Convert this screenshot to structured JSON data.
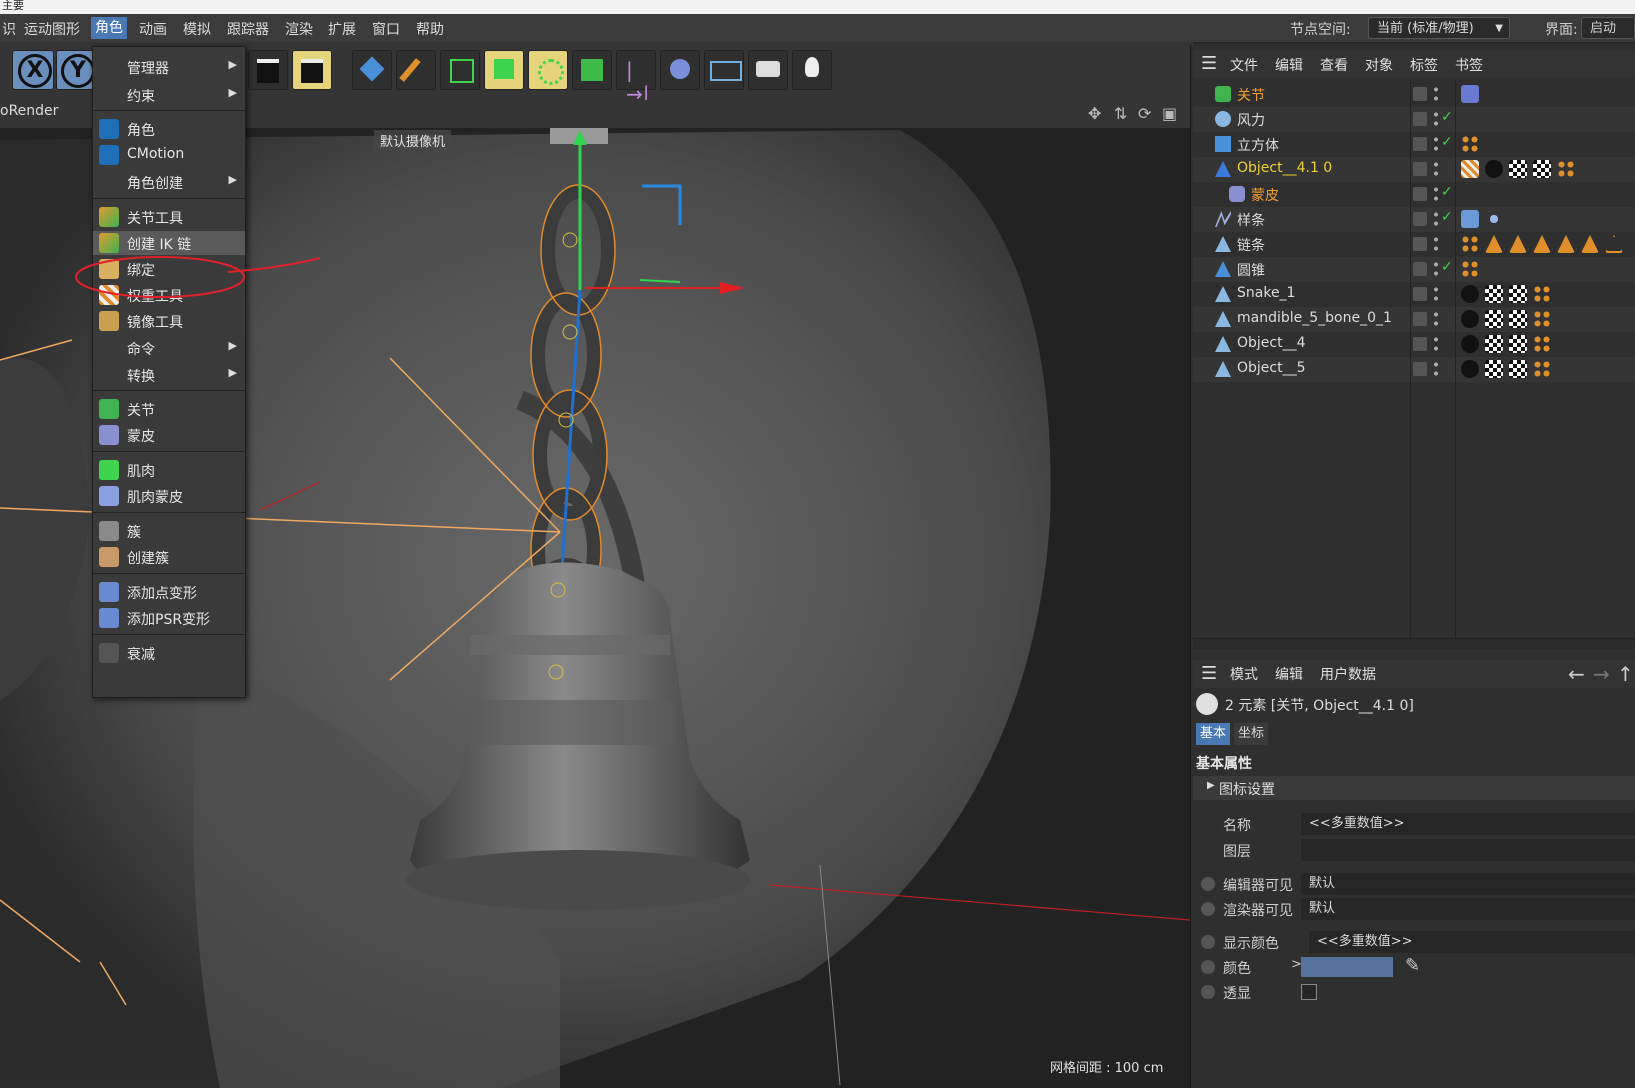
{
  "top_strip": {
    "title": "主要"
  },
  "menubar": {
    "items": [
      "识",
      "运动图形",
      "角色",
      "动画",
      "模拟",
      "跟踪器",
      "渲染",
      "扩展",
      "窗口",
      "帮助"
    ],
    "node_space_label": "节点空间:",
    "node_space_value": "当前 (标准/物理)",
    "interface_label": "界面:",
    "interface_value": "启动"
  },
  "viewport": {
    "renderer_label": "oRender",
    "camera_label": "默认摄像机",
    "grid_spacing": "网格间距 : 100 cm"
  },
  "character_menu": {
    "items": [
      {
        "label": "管理器",
        "submenu": true
      },
      {
        "label": "约束",
        "submenu": true
      },
      {
        "label": "角色",
        "submenu": false
      },
      {
        "label": "CMotion",
        "submenu": false
      },
      {
        "label": "角色创建",
        "submenu": true
      },
      {
        "label": "关节工具",
        "submenu": false
      },
      {
        "label": "创建 IK 链",
        "submenu": false
      },
      {
        "label": "绑定",
        "submenu": false
      },
      {
        "label": "权重工具",
        "submenu": false
      },
      {
        "label": "镜像工具",
        "submenu": false
      },
      {
        "label": "命令",
        "submenu": true
      },
      {
        "label": "转换",
        "submenu": true
      },
      {
        "label": "关节",
        "submenu": false
      },
      {
        "label": "蒙皮",
        "submenu": false
      },
      {
        "label": "肌肉",
        "submenu": false
      },
      {
        "label": "肌肉蒙皮",
        "submenu": false
      },
      {
        "label": "簇",
        "submenu": false
      },
      {
        "label": "创建簇",
        "submenu": false
      },
      {
        "label": "添加点变形",
        "submenu": false
      },
      {
        "label": "添加PSR变形",
        "submenu": false
      },
      {
        "label": "衰减",
        "submenu": false
      }
    ]
  },
  "object_manager": {
    "menu": [
      "文件",
      "编辑",
      "查看",
      "对象",
      "标签",
      "书签"
    ],
    "objects": [
      {
        "name": "关节",
        "highlight": true
      },
      {
        "name": "风力",
        "highlight": false
      },
      {
        "name": "立方体",
        "highlight": false
      },
      {
        "name": "Object__4.1 0",
        "highlight": true
      },
      {
        "name": "蒙皮",
        "highlight": true
      },
      {
        "name": "样条",
        "highlight": false
      },
      {
        "name": "链条",
        "highlight": false
      },
      {
        "name": "圆锥",
        "highlight": false
      },
      {
        "name": "Snake_1",
        "highlight": false
      },
      {
        "name": "mandible_5_bone_0_1",
        "highlight": false
      },
      {
        "name": "Object__4",
        "highlight": false
      },
      {
        "name": "Object__5",
        "highlight": false
      }
    ]
  },
  "attribute_manager": {
    "menu": [
      "模式",
      "编辑",
      "用户数据"
    ],
    "title": "2 元素 [关节, Object__4.1 0]",
    "tabs": [
      "基本",
      "坐标"
    ],
    "section": "基本属性",
    "icon_settings": "图标设置",
    "props": {
      "name_label": "名称",
      "name_value": "<<多重数值>>",
      "layer_label": "图层",
      "editor_visible_label": "编辑器可见",
      "editor_visible_value": "默认",
      "render_visible_label": "渲染器可见",
      "render_visible_value": "默认",
      "display_color_label": "显示颜色",
      "display_color_value": "<<多重数值>>",
      "color_label": "颜色",
      "transparency_label": "透显"
    }
  },
  "colors": {
    "accent": "#4a78b4",
    "highlight_orange": "#f0a030",
    "annotation_red": "#e0202a"
  }
}
